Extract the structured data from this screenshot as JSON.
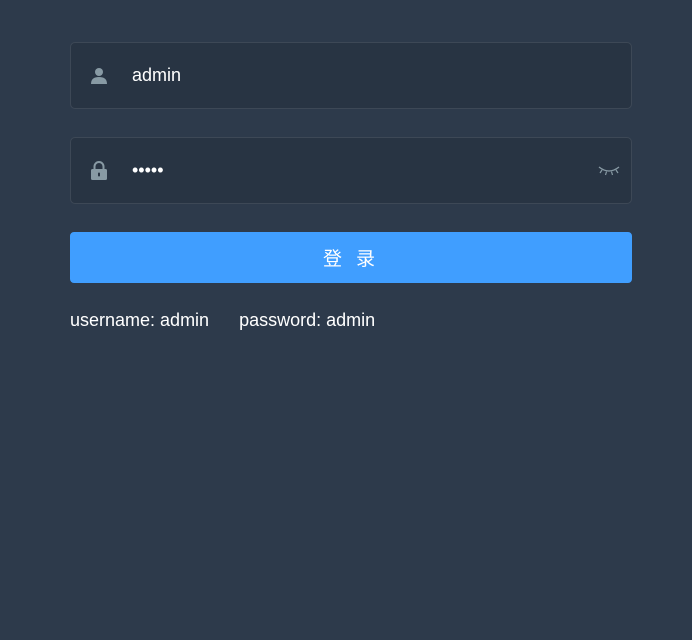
{
  "form": {
    "username": {
      "value": "admin",
      "icon": "user-icon"
    },
    "password": {
      "value": "admin",
      "icon": "lock-icon",
      "toggle_icon": "eye-closed-icon"
    },
    "login_label": "登 录",
    "tips": {
      "username": "username: admin",
      "password": "password: admin"
    }
  },
  "colors": {
    "background": "#2d3a4b",
    "input_background": "#283443",
    "icon": "#889aa4",
    "button": "#409eff",
    "text": "#ffffff"
  }
}
